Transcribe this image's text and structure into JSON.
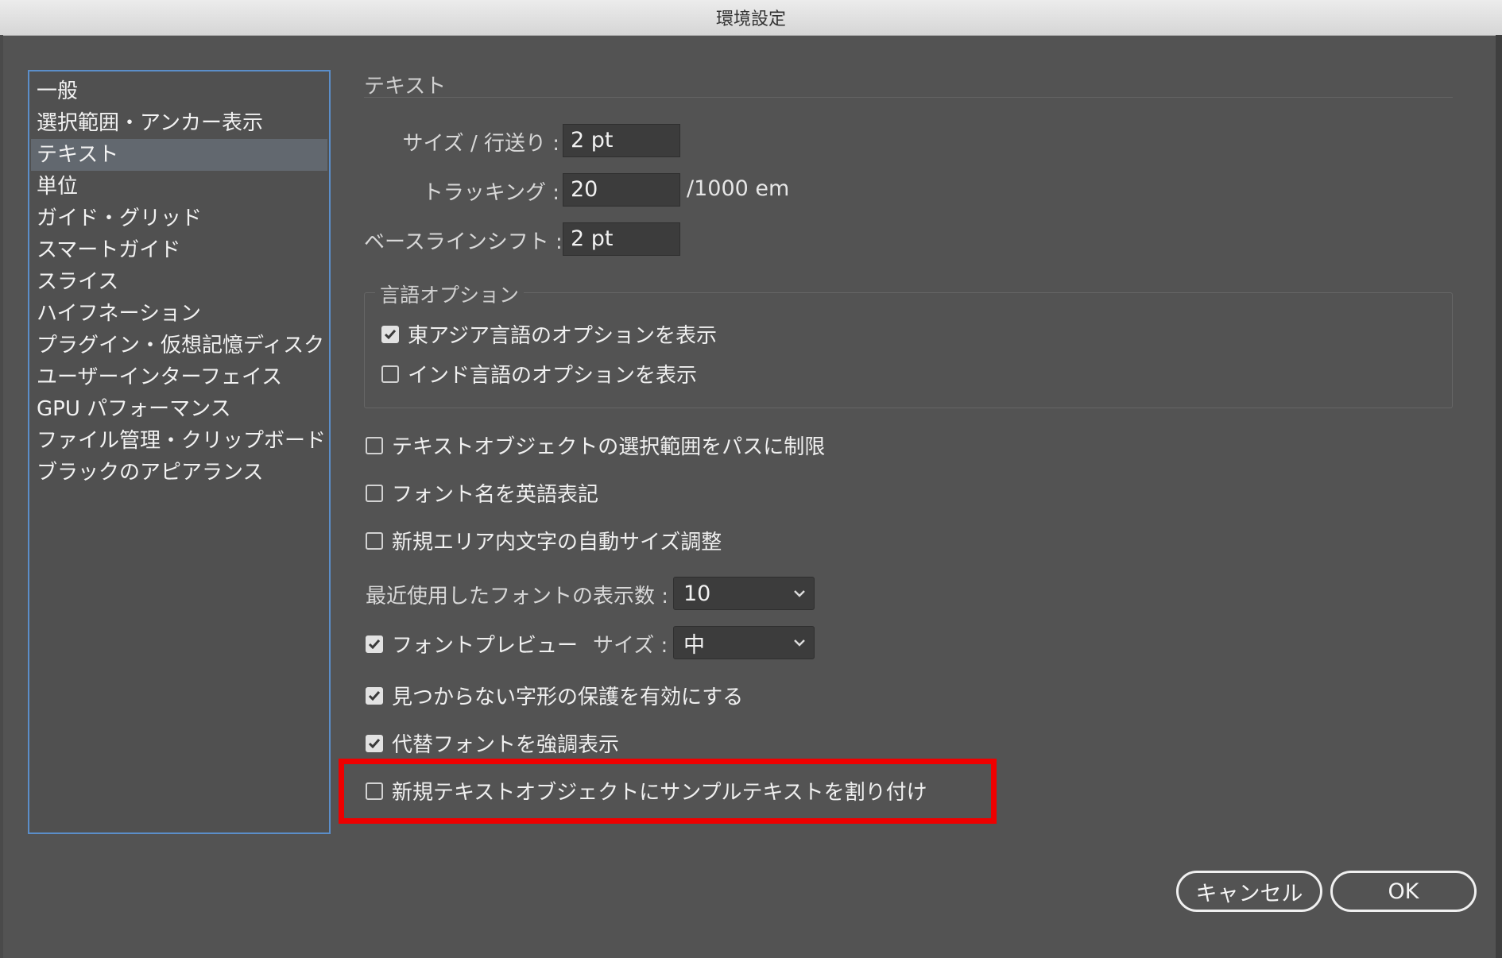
{
  "window": {
    "title": "環境設定"
  },
  "sidebar": {
    "items": [
      {
        "label": "一般"
      },
      {
        "label": "選択範囲・アンカー表示"
      },
      {
        "label": "テキスト",
        "selected": true
      },
      {
        "label": "単位"
      },
      {
        "label": "ガイド・グリッド"
      },
      {
        "label": "スマートガイド"
      },
      {
        "label": "スライス"
      },
      {
        "label": "ハイフネーション"
      },
      {
        "label": "プラグイン・仮想記憶ディスク"
      },
      {
        "label": "ユーザーインターフェイス"
      },
      {
        "label": "GPU パフォーマンス"
      },
      {
        "label": "ファイル管理・クリップボード"
      },
      {
        "label": "ブラックのアピアランス"
      }
    ]
  },
  "panel": {
    "section_title": "テキスト",
    "size_leading": {
      "label": "サイズ / 行送り :",
      "value": "2 pt"
    },
    "tracking": {
      "label": "トラッキング :",
      "value": "20",
      "unit": "/1000 em"
    },
    "baseline_shift": {
      "label": "ベースラインシフト :",
      "value": "2 pt"
    },
    "language_options": {
      "title": "言語オプション",
      "east_asian": {
        "label": "東アジア言語のオプションを表示",
        "checked": true
      },
      "indic": {
        "label": "インド言語のオプションを表示",
        "checked": false
      }
    },
    "options": {
      "restrict_selection": {
        "label": "テキストオブジェクトの選択範囲をパスに制限",
        "checked": false
      },
      "english_font_names": {
        "label": "フォント名を英語表記",
        "checked": false
      },
      "auto_size_area": {
        "label": "新規エリア内文字の自動サイズ調整",
        "checked": false
      }
    },
    "recent_fonts": {
      "label": "最近使用したフォントの表示数 :",
      "value": "10"
    },
    "font_preview": {
      "label": "フォントプレビュー",
      "checked": true,
      "size_label": "サイズ :",
      "size_value": "中"
    },
    "protect_missing_glyphs": {
      "label": "見つからない字形の保護を有効にする",
      "checked": true
    },
    "highlight_substituted": {
      "label": "代替フォントを強調表示",
      "checked": true
    },
    "fill_placeholder": {
      "label": "新規テキストオブジェクトにサンプルテキストを割り付け",
      "checked": false
    }
  },
  "buttons": {
    "cancel": "キャンセル",
    "ok": "OK"
  },
  "colors": {
    "highlight": "#ee0000",
    "sidebar_border": "#5b8ec9",
    "background": "#535353"
  }
}
